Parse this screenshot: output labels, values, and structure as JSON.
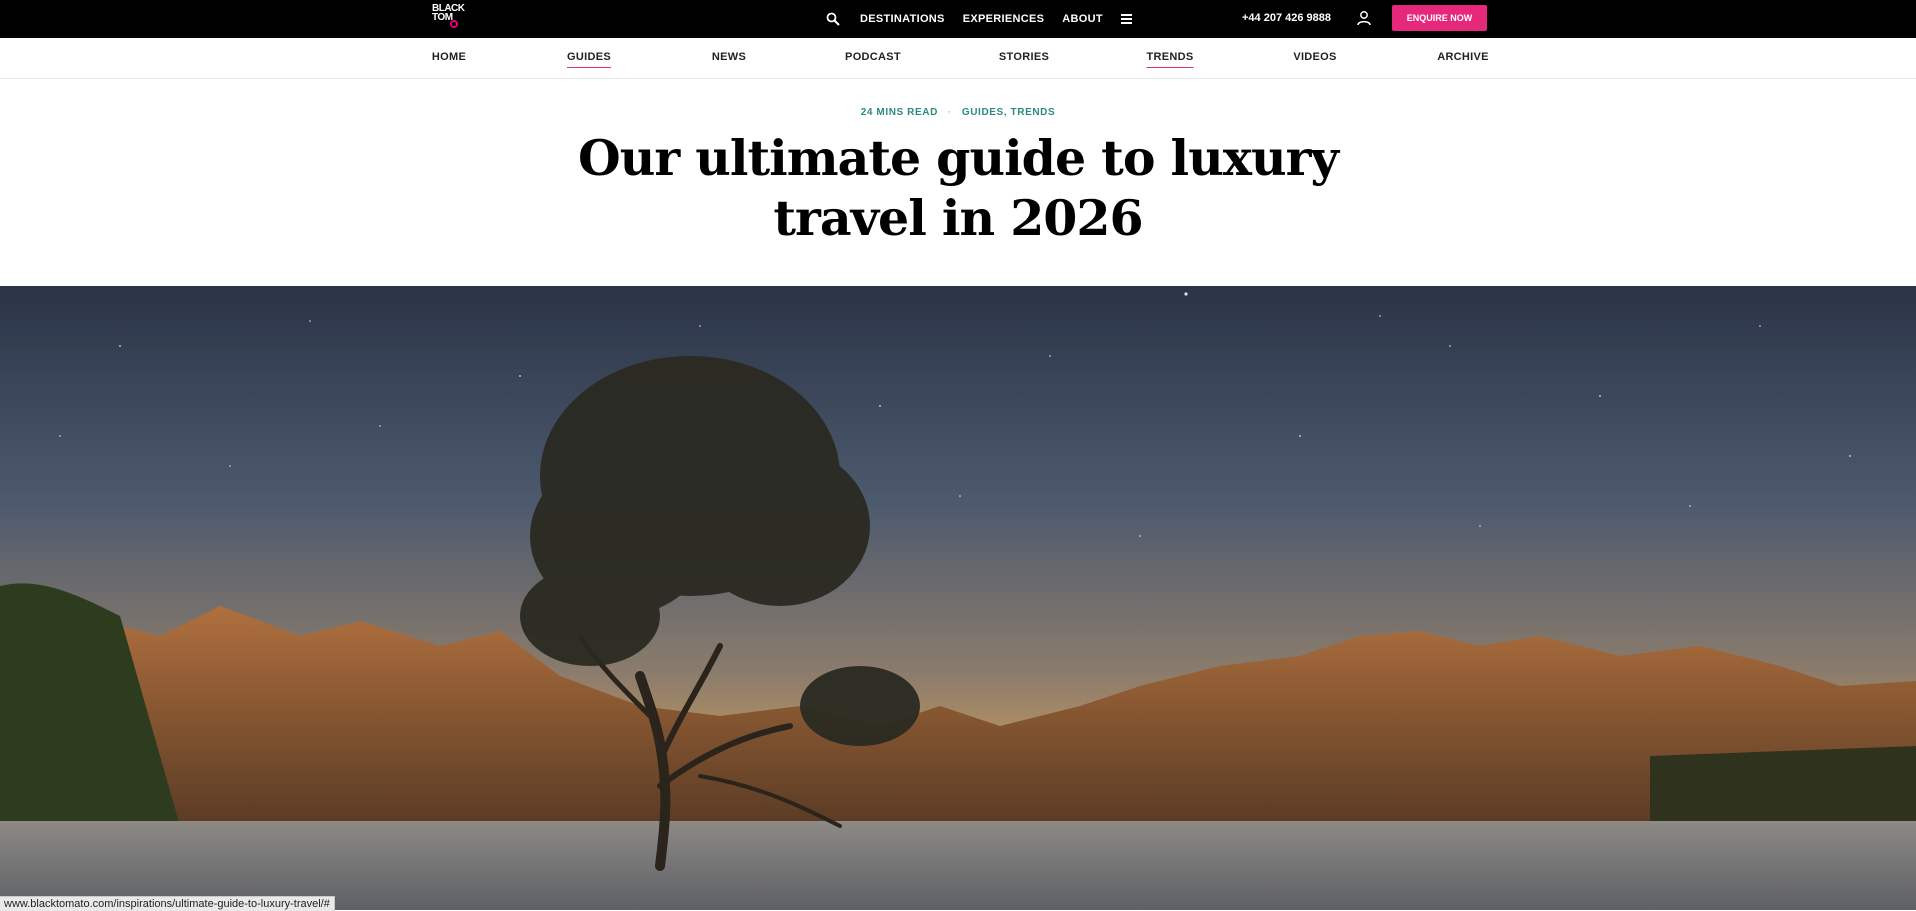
{
  "header": {
    "logo_text": [
      "BLACK",
      "TOMATO"
    ],
    "nav": [
      "DESTINATIONS",
      "EXPERIENCES",
      "ABOUT"
    ],
    "phone": "+44 207 426 9888",
    "cta": "ENQUIRE NOW",
    "brand_color": "#e6287a"
  },
  "subnav": {
    "items": [
      "HOME",
      "GUIDES",
      "NEWS",
      "PODCAST",
      "STORIES",
      "TRENDS",
      "VIDEOS",
      "ARCHIVE"
    ],
    "active": [
      "GUIDES",
      "TRENDS"
    ]
  },
  "article": {
    "read_time": "24 MINS READ",
    "categories": "GUIDES, TRENDS",
    "title": "Our ultimate guide to luxury travel in 2026"
  },
  "status": {
    "url": "www.blacktomato.com/inspirations/ultimate-guide-to-luxury-travel/#"
  }
}
